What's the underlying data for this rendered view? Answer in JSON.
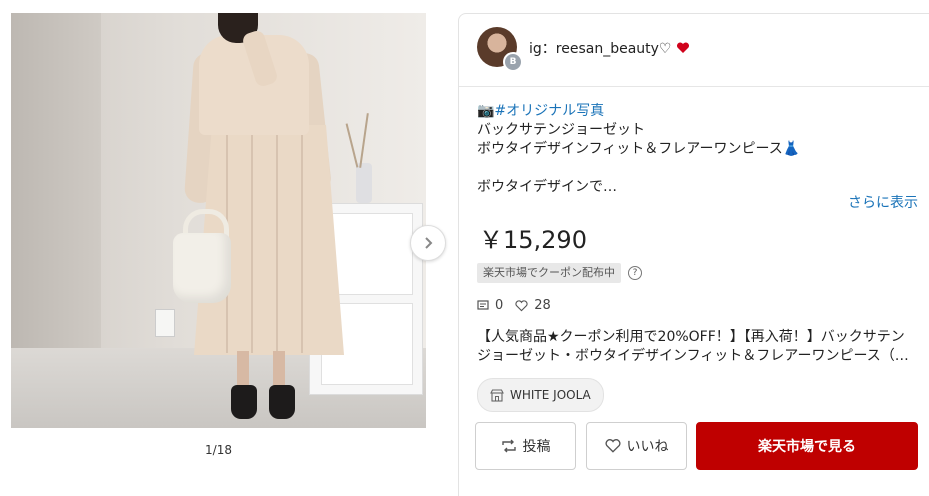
{
  "gallery": {
    "counter": "1/18",
    "next_icon": "chevron-right-icon"
  },
  "post": {
    "username": "ig：reesan_beauty♡",
    "hashtag": "📷#オリジナル写真",
    "title_lines": [
      "バックサテンジョーゼット",
      "ボウタイデザインフィット＆フレアーワンピース👗",
      "",
      "ボウタイデザインで…"
    ],
    "more_label": "さらに表示",
    "price": "￥15,290",
    "coupon_label": "楽天市場でクーポン配布中",
    "help_icon": "?",
    "comments": "0",
    "likes": "28",
    "description": "【人気商品★クーポン利用で20%OFF！】【再入荷！】バックサテンジョーゼット・ボウタイデザインフィット＆フレアーワンピース（…",
    "shop_name": "WHITE JOOLA",
    "post_button": "投稿",
    "like_button": "いいね",
    "buy_button": "楽天市場で見る",
    "avatar_badge": "B"
  },
  "colors": {
    "accent_link": "#1a73b8",
    "buy_button": "#bf0000",
    "heart": "#d0021b"
  }
}
